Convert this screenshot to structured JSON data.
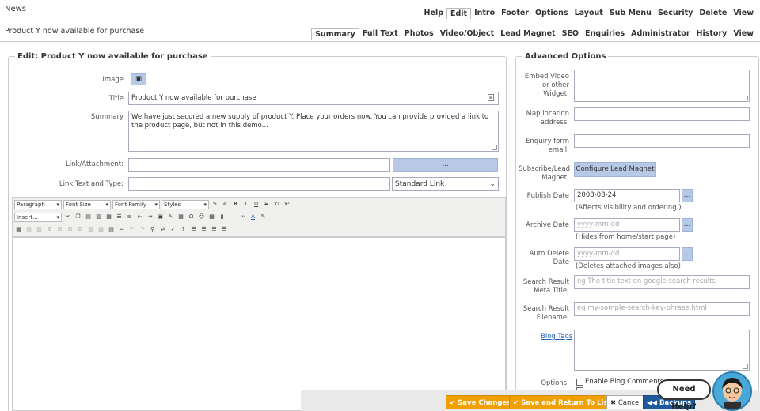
{
  "header": {
    "title": "News",
    "nav": [
      "Help",
      "Edit",
      "Intro",
      "Footer",
      "Options",
      "Layout",
      "Sub Menu",
      "Security",
      "Delete",
      "View"
    ],
    "active": "Edit"
  },
  "subheader": {
    "title": "Product Y now available for purchase",
    "tabs": [
      "Summary",
      "Full Text",
      "Photos",
      "Video/Object",
      "Lead Magnet",
      "SEO",
      "Enquiries",
      "Administrator",
      "History",
      "View"
    ],
    "active": "Summary"
  },
  "edit": {
    "legend": "Edit: Product Y now available for purchase",
    "image_label": "Image",
    "title_label": "Title",
    "title_value": "Product Y now available for purchase",
    "summary_label": "Summary",
    "summary_value": "We have just secured a new supply of product Y. Place your orders now. You can provide provided a link to the product page, but not in this demo...",
    "link_label": "Link/Attachment:",
    "link_button": "...",
    "linktext_label": "Link Text and Type:",
    "link_type": "Standard Link"
  },
  "toolbar": {
    "paragraph": "Paragraph",
    "font_size": "Font Size",
    "font_family": "Font Family",
    "styles": "Styles",
    "insert": "Insert..."
  },
  "advanced": {
    "legend": "Advanced Options",
    "embed_label": "Embed Video or other Widget:",
    "map_label": "Map location address:",
    "enquiry_label": "Enquiry form email:",
    "subscribe_label": "Subscribe/Lead Magnet:",
    "configure_button": "Configure Lead Magnet",
    "publish_label": "Publish Date",
    "publish_value": "2008-08-24",
    "publish_hint": "(Affects visibility and ordering.)",
    "archive_label": "Archive Date",
    "archive_placeholder": "yyyy-mm-dd",
    "archive_hint": "(Hides from home/start page)",
    "autodelete_label": "Auto Delete Date",
    "autodelete_placeholder": "yyyy-mm-dd",
    "autodelete_hint": "(Deletes attached images also)",
    "meta_label": "Search Result Meta Title:",
    "meta_placeholder": "eg The title text on google search results",
    "filename_label": "Search Result Filename:",
    "filename_placeholder": "eg my-sample-search-key-phrase.html",
    "tags_link": "Blog Tags",
    "options_label": "Options:",
    "option_blog_comments": "Enable Blog Comments"
  },
  "footer": {
    "save": "✔ Save Changes",
    "save_return": "✔ Save and Return To List",
    "cancel": "✖ Cancel",
    "backups": "◀◀ Backups"
  },
  "help": {
    "label": "Need Help?"
  },
  "colors": {
    "orange": "#f0a000",
    "blue": "#1e5a9a",
    "button_gray": "#b8c9e6"
  }
}
